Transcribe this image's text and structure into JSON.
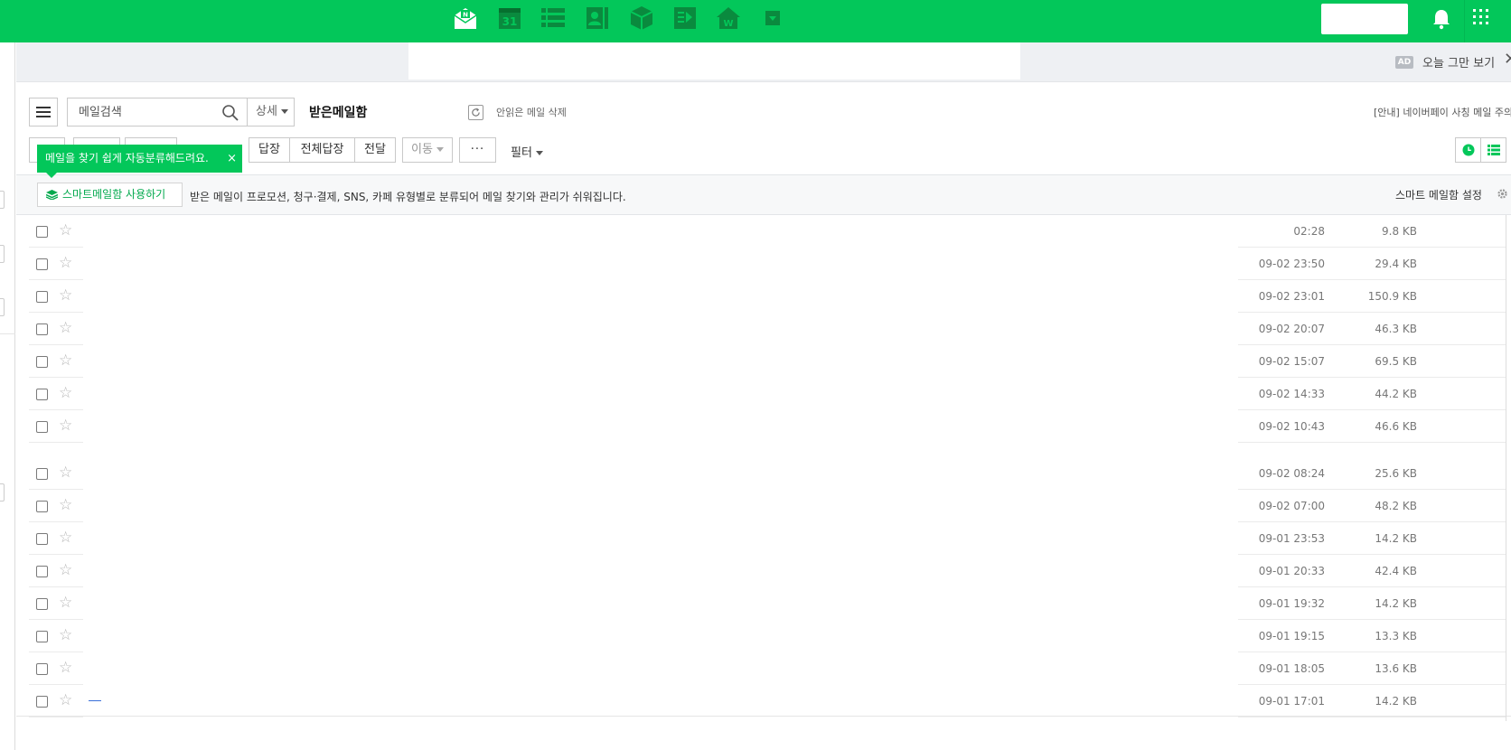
{
  "topbar": {
    "apps": [
      {
        "name": "mail-app-icon"
      },
      {
        "name": "calendar-app-icon",
        "label": "31"
      },
      {
        "name": "contacts-list-app-icon"
      },
      {
        "name": "address-book-app-icon"
      },
      {
        "name": "mybox-app-icon"
      },
      {
        "name": "memo-app-icon"
      },
      {
        "name": "works-app-icon",
        "label": "W"
      },
      {
        "name": "more-apps-dropdown-icon"
      }
    ],
    "color": "#03c75a"
  },
  "ad": {
    "badge": "AD",
    "hide_today": "오늘 그만 보기",
    "close": "✕"
  },
  "toolbar": {
    "search_placeholder": "메일검색",
    "detail_label": "상세",
    "folder_title": "받은메일함",
    "delete_unread": "안읽은 메일 삭제",
    "notice": "[안내] 네이버페이 사칭 메일 주의",
    "reply": "답장",
    "reply_all": "전체답장",
    "forward": "전달",
    "move": "이동",
    "more": "···",
    "filter": "필터"
  },
  "tooltip": {
    "text": "메일을 찾기 쉽게 자동분류해드려요.",
    "close": "×"
  },
  "smart": {
    "button": "스마트메일함 사용하기",
    "description": "받은 메일이 프로모션, 청구·결제, SNS, 카페 유형별로 분류되어 메일 찾기와 관리가 쉬워집니다.",
    "settings": "스마트 메일함 설정"
  },
  "mails": [
    {
      "date": "02:28",
      "size": "9.8 KB"
    },
    {
      "date": "09-02 23:50",
      "size": "29.4 KB"
    },
    {
      "date": "09-02 23:01",
      "size": "150.9 KB"
    },
    {
      "date": "09-02 20:07",
      "size": "46.3 KB"
    },
    {
      "date": "09-02 15:07",
      "size": "69.5 KB"
    },
    {
      "date": "09-02 14:33",
      "size": "44.2 KB"
    },
    {
      "date": "09-02 10:43",
      "size": "46.6 KB"
    },
    {
      "date": "09-02 08:24",
      "size": "25.6 KB"
    },
    {
      "date": "09-02 07:00",
      "size": "48.2 KB"
    },
    {
      "date": "09-01 23:53",
      "size": "14.2 KB"
    },
    {
      "date": "09-01 20:33",
      "size": "42.4 KB"
    },
    {
      "date": "09-01 19:32",
      "size": "14.2 KB"
    },
    {
      "date": "09-01 19:15",
      "size": "13.3 KB"
    },
    {
      "date": "09-01 18:05",
      "size": "13.6 KB"
    },
    {
      "date": "09-01 17:01",
      "size": "14.2 KB"
    }
  ]
}
